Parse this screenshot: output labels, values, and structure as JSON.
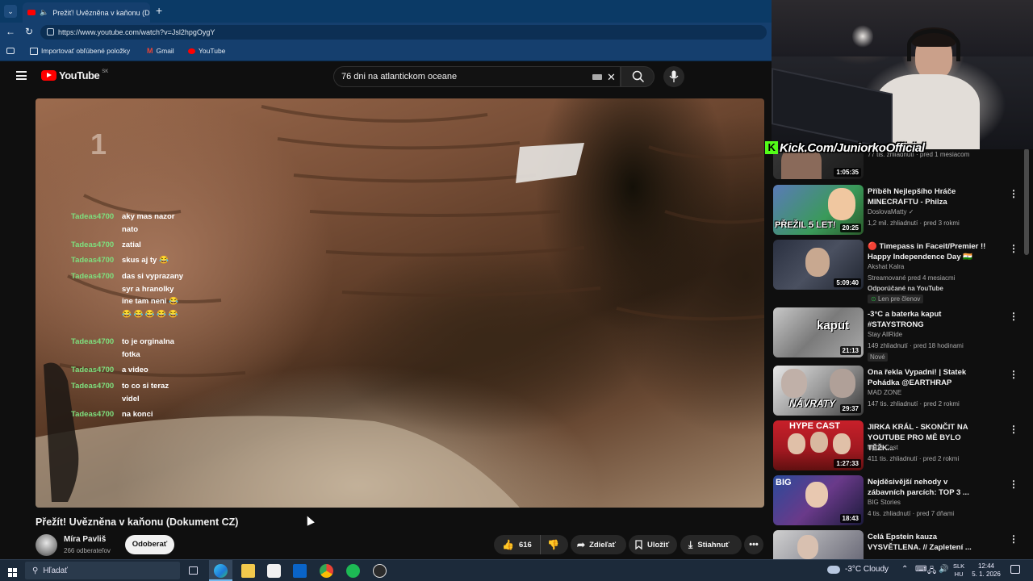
{
  "browser": {
    "tab_title": "Prežiť! Uvězněna v kaňonu (D",
    "url": "https://www.youtube.com/watch?v=Jsl2hpgOygY",
    "bookmarks": [
      "Importovať obľúbené položky",
      "Gmail",
      "YouTube"
    ]
  },
  "youtube": {
    "logo_text": "YouTube",
    "region": "SK",
    "search_value": "76 dni na atlantickom oceane"
  },
  "overlay": {
    "counter_text": "1",
    "kick_text": "Kick.Com/JuniorkoOfficial",
    "chat": [
      {
        "user": "Tadeas4700",
        "msg": "aky mas nazor nato"
      },
      {
        "user": "Tadeas4700",
        "msg": "zatial"
      },
      {
        "user": "Tadeas4700",
        "msg": "skus aj ty 😂"
      },
      {
        "user": "Tadeas4700",
        "msg": "das si vyprazany syr a hranolky ine tam neni 😂 😂 😂 😂 😂 😂"
      },
      {
        "user": "Tadeas4700",
        "msg": "to je orginalna fotka"
      },
      {
        "user": "Tadeas4700",
        "msg": "a video"
      },
      {
        "user": "Tadeas4700",
        "msg": "to co si teraz videl"
      },
      {
        "user": "Tadeas4700",
        "msg": "na konci"
      }
    ]
  },
  "video": {
    "title": "Přežít! Uvězněna v kaňonu (Dokument CZ)",
    "channel": "Míra Pavliš",
    "subscribers": "266 odberateľov",
    "subscribe_label": "Odoberať",
    "likes": "616",
    "share_label": "Zdieľať",
    "save_label": "Uložiť",
    "download_label": "Stiahnuť"
  },
  "recommendations": [
    {
      "title": "",
      "channel": "",
      "meta": "77 tis. zhliadnutí · pred 1 mesiacom",
      "duration": "1:05:35"
    },
    {
      "title": "Příběh Nejlepšího Hráče MINECRAFTU - Philza",
      "channel": "DoslovaMatty",
      "meta": "1,2 mil. zhliadnutí · pred 3 rokmi",
      "duration": "20:25",
      "thumb_text": "PŘEŽIL 5 LET!"
    },
    {
      "title": "🔴 Timepass in Faceit/Premier !! Happy Independence Day 🇮🇳",
      "channel": "Akshat Kalra",
      "meta": "Streamované pred 4 mesiacmi",
      "extra": "Odporúčané na YouTube",
      "badge": "Len pre členov",
      "duration": "5:09:40"
    },
    {
      "title": "-3°C a baterka kaput #STAYSTRONG",
      "channel": "Stay AllRide",
      "meta": "149 zhliadnutí · pred 18 hodinami",
      "badge": "Nové",
      "duration": "21:13",
      "thumb_text": "kaput"
    },
    {
      "title": "Ona řekla Vypadni! | Statek Pohádka @EARTHRAP",
      "channel": "MAD ZONE",
      "meta": "147 tis. zhliadnutí · pred 2 rokmi",
      "duration": "29:37",
      "thumb_text": "NÁVRATY"
    },
    {
      "title": "JIRKA KRÁL - SKONČIT NA YOUTUBE PRO MĚ BYLO TĚŽK...",
      "channel": "Hype-Cast",
      "meta": "411 tis. zhliadnutí · pred 2 rokmi",
      "duration": "1:27:33",
      "thumb_text": "HYPE CAST"
    },
    {
      "title": "Nejděsivější nehody v zábavních parcích: TOP 3 ...",
      "channel": "BIG Stories",
      "meta": "4 tis. zhliadnutí · pred 7 dňami",
      "duration": "18:43",
      "thumb_text": "BIG"
    },
    {
      "title": "Celá Epstein kauza VYSVĚTLENA. // Zapletení ...",
      "channel": "",
      "meta": "",
      "duration": ""
    }
  ],
  "taskbar": {
    "search_placeholder": "Hľadať",
    "weather": "-3°C  Cloudy",
    "lang_top": "SLK",
    "lang_bottom": "HU",
    "time": "12:44",
    "date": "5. 1. 2026"
  },
  "colors": {
    "youtube_red": "#ff0000",
    "chat_username": "#7ee07e",
    "kick_green": "#53fc18",
    "browser_blue": "#153f6e"
  }
}
